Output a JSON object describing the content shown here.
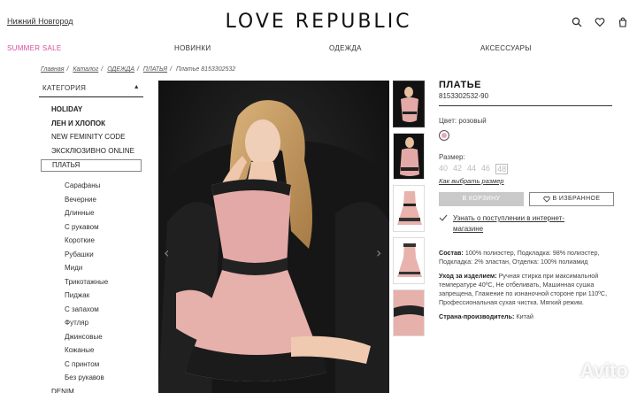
{
  "header": {
    "city": "Нижний Новгород",
    "logo": "LOVE REPUBLIC"
  },
  "nav": [
    "SUMMER SALE",
    "НОВИНКИ",
    "ОДЕЖДА",
    "АКСЕССУАРЫ"
  ],
  "breadcrumb": [
    "Главная",
    "Каталог",
    "ОДЕЖДА",
    "ПЛАТЬЯ",
    "Платье 8153302532"
  ],
  "sidebar": {
    "heading": "КАТЕГОРИЯ",
    "top": [
      "HOLIDAY",
      "ЛЕН И ХЛОПОК",
      "NEW FEMINITY CODE",
      "ЭКСКЛЮЗИВНО ONLINE"
    ],
    "current": "ПЛАТЬЯ",
    "sub": [
      "Сарафаны",
      "Вечерние",
      "Длинные",
      "С рукавом",
      "Короткие",
      "Рубашки",
      "Миди",
      "Трикотажные",
      "Пиджак",
      "С запахом",
      "Футляр",
      "Джинсовые",
      "Кожаные",
      "С принтом",
      "Без рукавов"
    ],
    "bottom": "DENIM"
  },
  "product": {
    "title": "ПЛАТЬЕ",
    "sku": "8153302532-90",
    "color_label": "Цвет:",
    "color_value": "розовый",
    "swatch_color": "#e7a9b7",
    "size_label": "Размер:",
    "sizes": [
      "40",
      "42",
      "44",
      "46",
      "48"
    ],
    "size_chart": "Как выбрать размер",
    "cart_button": "В КОРЗИНУ",
    "fav_button": "В ИЗБРАННОЕ",
    "notify": "Узнать о поступлении в интернет-магазине",
    "composition_label": "Состав:",
    "composition": "100% полиэстер, Подкладка: 98% полиэстер, Подкладка: 2% эластан, Отделка: 100% полиамид",
    "care_label": "Уход за изделием:",
    "care": "Ручная стирка при максимальной температуре 40ºС, Не отбеливать, Машинная сушка запрещена, Глажение по изнаночной стороне при 110ºС, Профессиональная сухая чистка. Мягкий режим.",
    "country_label": "Страна-производитель:",
    "country": "Китай"
  },
  "watermark": "Avito"
}
